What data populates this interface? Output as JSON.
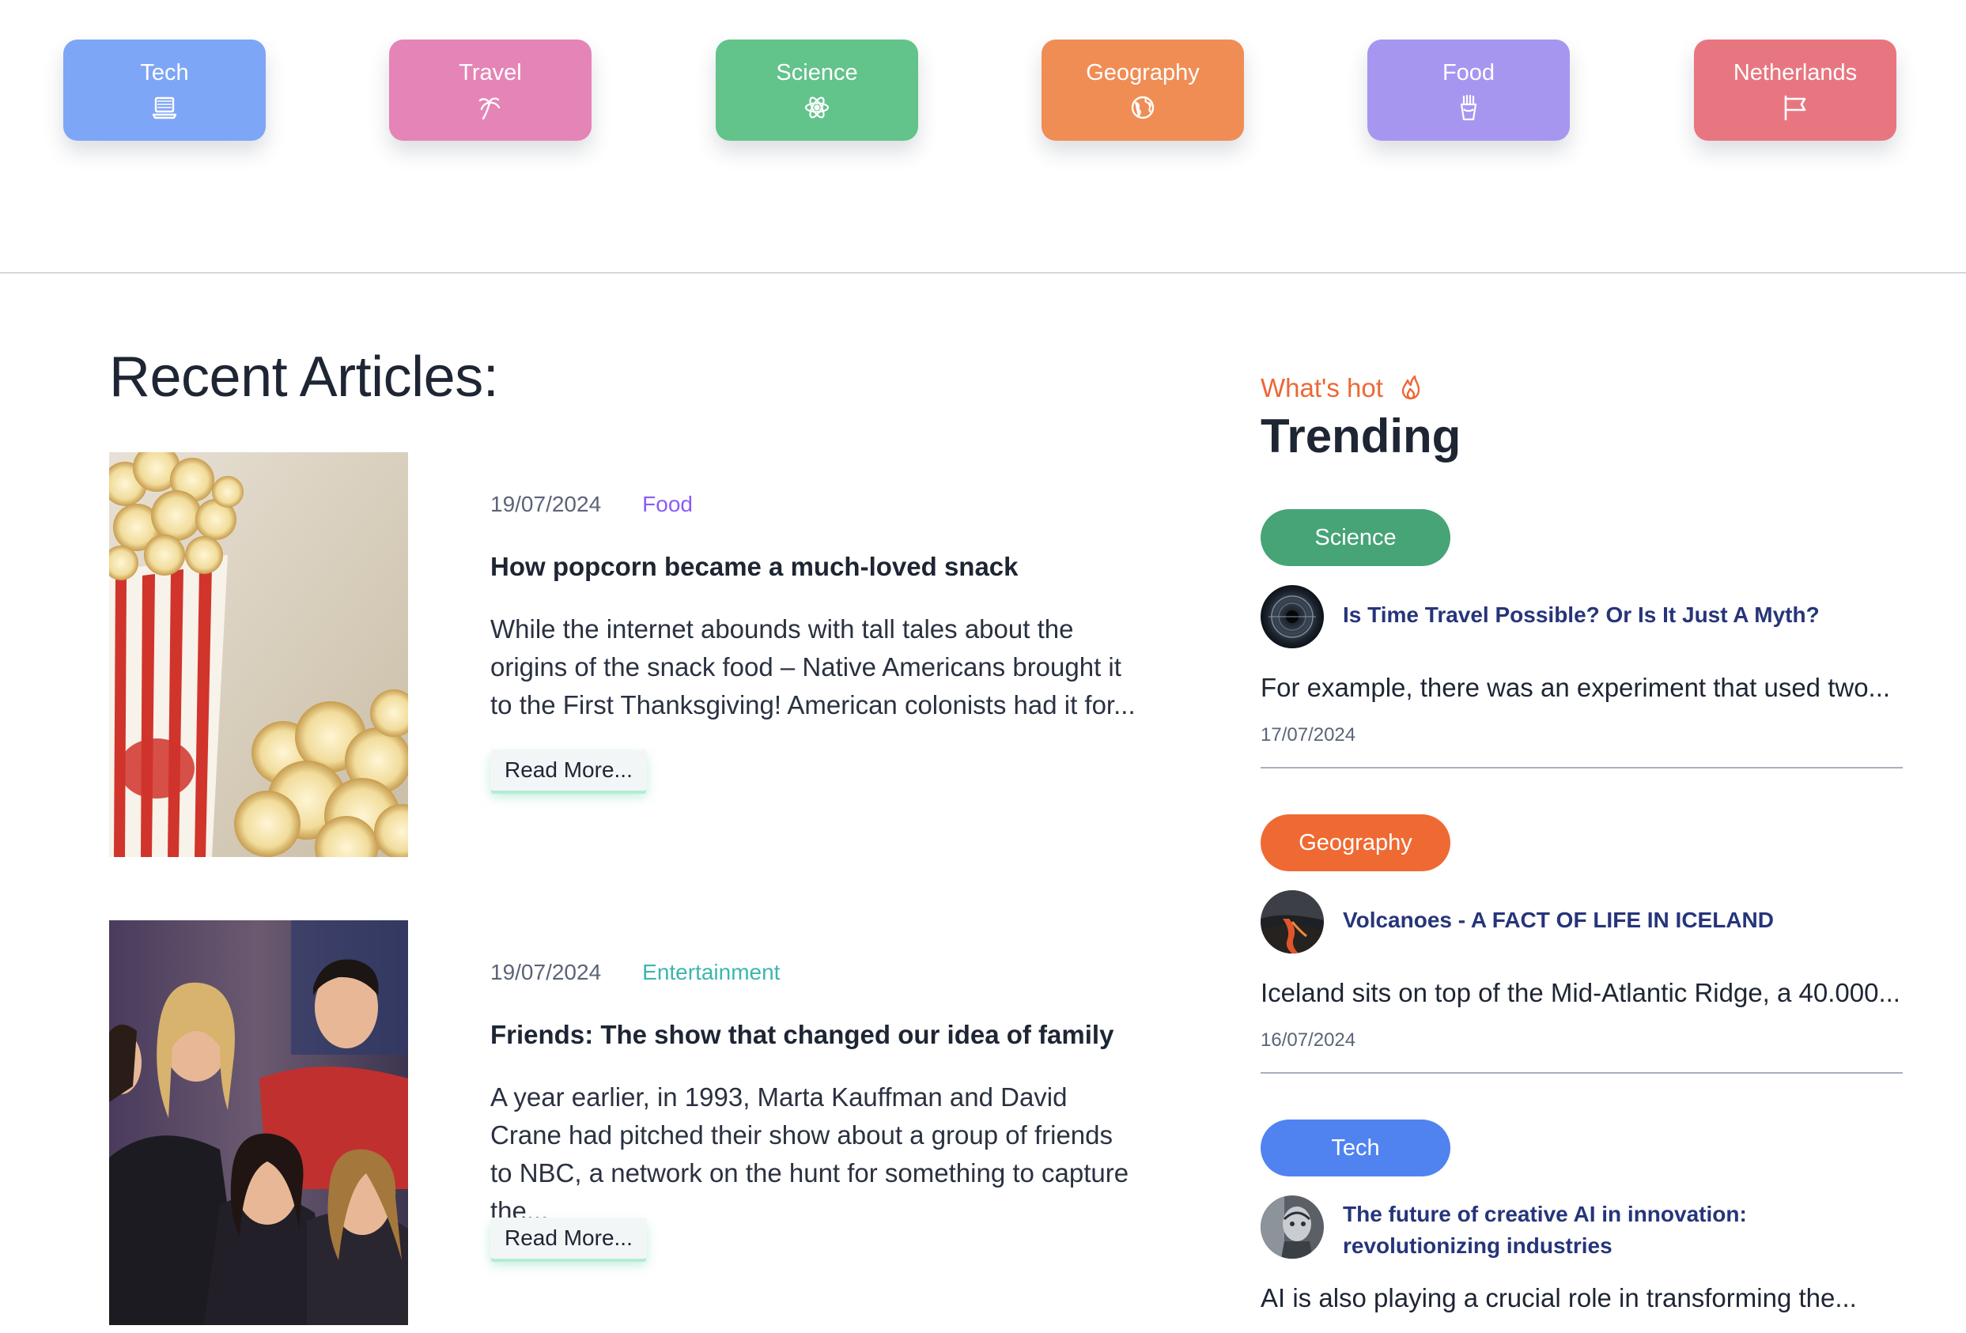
{
  "categories": [
    {
      "label": "Tech",
      "icon": "laptop-icon",
      "color": "#7ea6f6"
    },
    {
      "label": "Travel",
      "icon": "palm-tree-icon",
      "color": "#e584b6"
    },
    {
      "label": "Science",
      "icon": "atom-icon",
      "color": "#62c38b"
    },
    {
      "label": "Geography",
      "icon": "globe-icon",
      "color": "#f08d55"
    },
    {
      "label": "Food",
      "icon": "fries-icon",
      "color": "#a796f0"
    },
    {
      "label": "Netherlands",
      "icon": "flag-icon",
      "color": "#e87680"
    }
  ],
  "recent": {
    "title": "Recent Articles:",
    "articles": [
      {
        "date": "19/07/2024",
        "category": "Food",
        "category_color": "#8b5cf6",
        "image": "popcorn-photo",
        "title": "How popcorn became a much-loved snack",
        "excerpt": "While the internet abounds with tall tales about the origins of the snack food – Native Americans brought it to the First Thanksgiving! American colonists had it for...",
        "button": "Read More..."
      },
      {
        "date": "19/07/2024",
        "category": "Entertainment",
        "category_color": "#3db5ae",
        "image": "friends-cast-photo",
        "title": "Friends: The show that changed our idea of family",
        "excerpt": "A year earlier, in 1993, Marta Kauffman and David Crane had pitched their show about a group of friends to NBC, a network on the hunt for something to capture the...",
        "button": "Read More..."
      }
    ]
  },
  "trending": {
    "kicker": "What's hot",
    "kicker_icon": "flame-icon",
    "title": "Trending",
    "items": [
      {
        "category": "Science",
        "color": "#46a477",
        "thumb": "wormhole-thumbnail",
        "title": "Is Time Travel Possible? Or Is It Just A Myth?",
        "excerpt": "For example, there was an experiment that used two...",
        "date": "17/07/2024"
      },
      {
        "category": "Geography",
        "color": "#ef6a32",
        "thumb": "volcano-thumbnail",
        "title": "Volcanoes - A FACT OF LIFE IN ICELAND",
        "excerpt": "Iceland sits on top of the Mid-Atlantic Ridge, a 40.000...",
        "date": "16/07/2024"
      },
      {
        "category": "Tech",
        "color": "#5083f0",
        "thumb": "ai-robot-thumbnail",
        "title": "The future of creative AI in innovation: revolutionizing industries",
        "excerpt": "AI is also playing a crucial role in transforming the..."
      }
    ]
  }
}
